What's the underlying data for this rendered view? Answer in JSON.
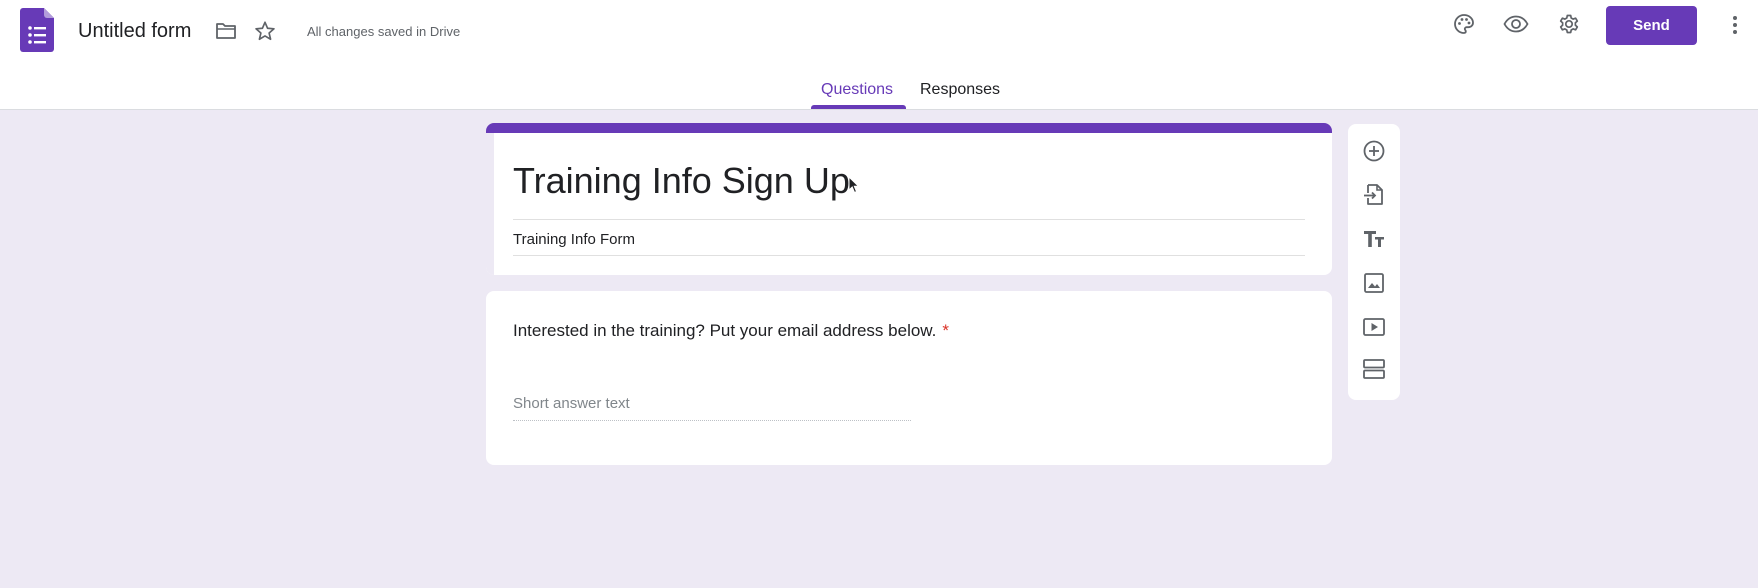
{
  "header": {
    "doc_title": "Untitled form",
    "save_status": "All changes saved in Drive",
    "send_label": "Send",
    "icons": {
      "logo": "google-forms-logo",
      "folder": "folder-icon",
      "star": "star-icon",
      "palette": "palette-icon",
      "preview": "eye-icon",
      "settings": "gear-icon",
      "more": "more-vert-icon"
    }
  },
  "tabs": [
    {
      "label": "Questions",
      "active": true
    },
    {
      "label": "Responses",
      "active": false
    }
  ],
  "form": {
    "title": "Training Info Sign Up",
    "description": "Training Info Form"
  },
  "question": {
    "text": "Interested in the training? Put your email address below.",
    "required_mark": "*",
    "answer_placeholder": "Short answer text"
  },
  "toolbar": [
    "add-question-icon",
    "import-questions-icon",
    "add-title-icon",
    "add-image-icon",
    "add-video-icon",
    "add-section-icon"
  ],
  "colors": {
    "accent": "#673ab7",
    "background": "#ede9f4",
    "required": "#d93025"
  }
}
